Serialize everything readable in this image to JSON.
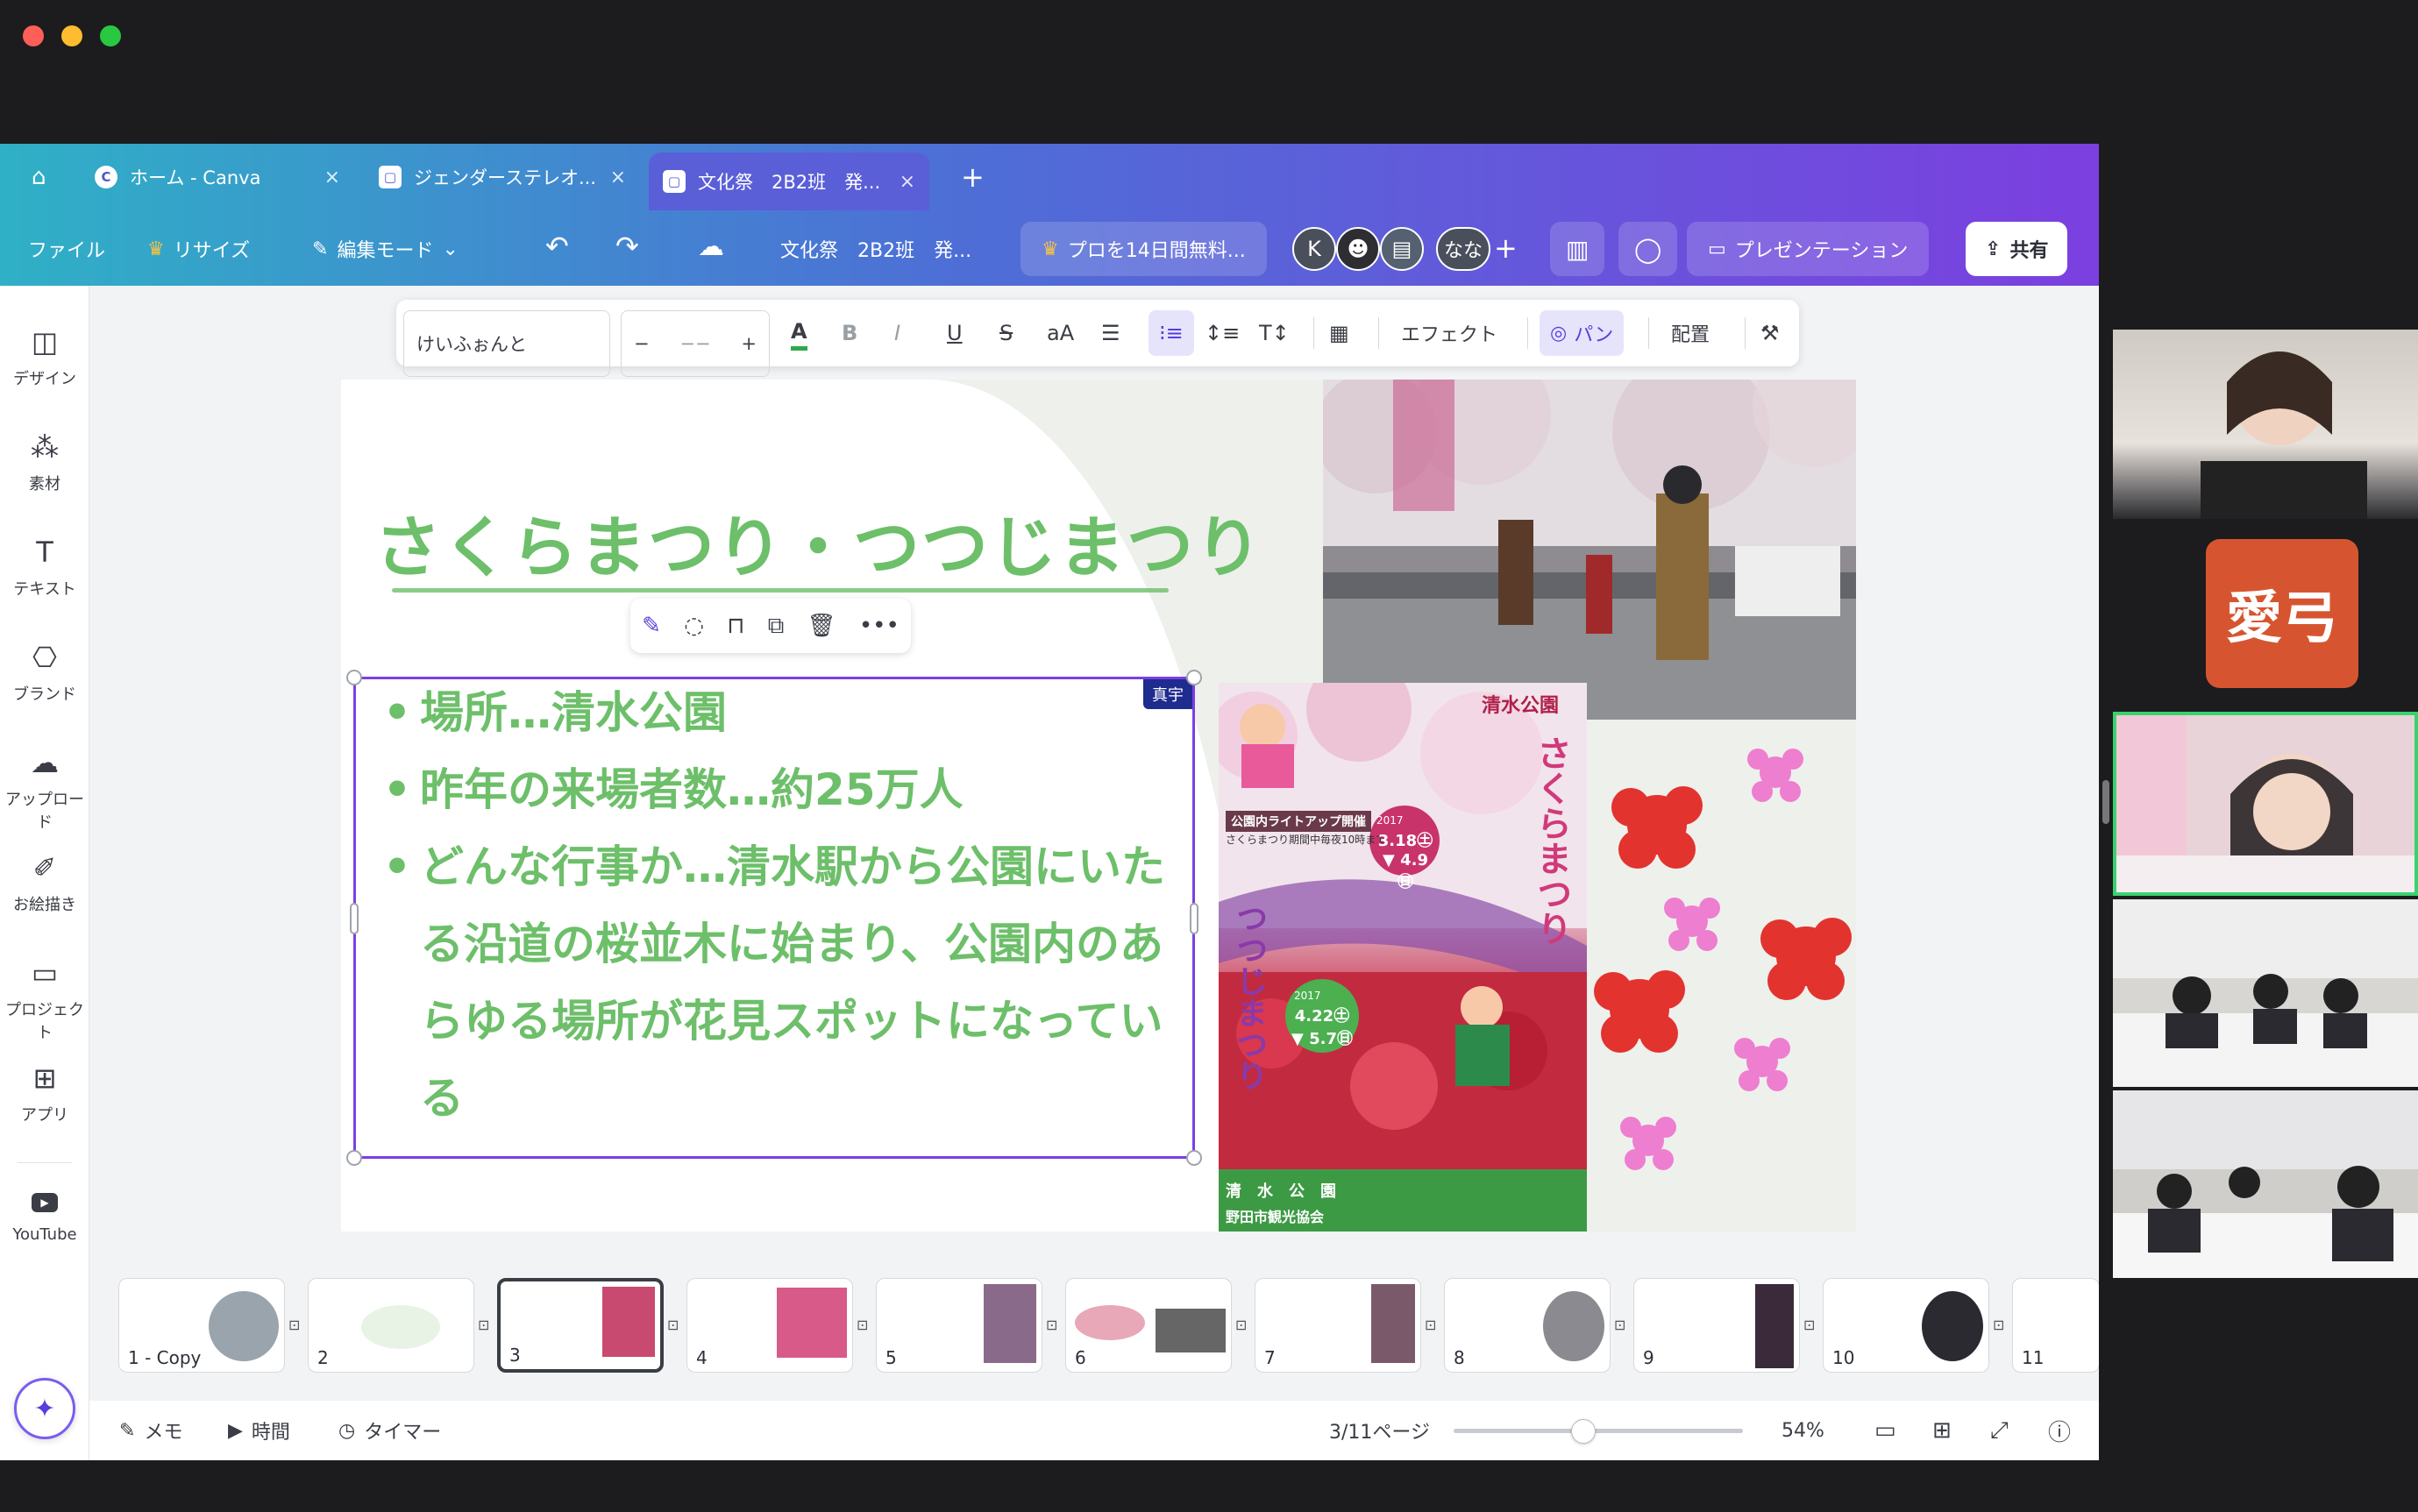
{
  "tabs": [
    {
      "label": "ホーム - Canva"
    },
    {
      "label": "ジェンダーステレオ..."
    },
    {
      "label": "文化祭　2B2班　発..."
    }
  ],
  "menu": {
    "file": "ファイル",
    "resize": "リサイズ",
    "edit_mode": "編集モード",
    "doc_title": "文化祭　2B2班　発...",
    "pro_trial": "プロを14日間無料...",
    "avatar_k": "K",
    "avatar_nana": "なな",
    "present": "プレゼンテーション",
    "share": "共有"
  },
  "sidebar": [
    {
      "label": "デザイン",
      "icon": "design-icon"
    },
    {
      "label": "素材",
      "icon": "elements-icon"
    },
    {
      "label": "テキスト",
      "icon": "text-icon"
    },
    {
      "label": "ブランド",
      "icon": "brand-icon"
    },
    {
      "label": "アップロード",
      "icon": "upload-icon"
    },
    {
      "label": "お絵描き",
      "icon": "draw-icon"
    },
    {
      "label": "プロジェクト",
      "icon": "folder-icon"
    },
    {
      "label": "アプリ",
      "icon": "apps-icon"
    },
    {
      "label": "YouTube",
      "icon": "youtube-icon"
    }
  ],
  "format_toolbar": {
    "font": "けいふぉんと",
    "minus": "−",
    "size": "−−",
    "plus": "+",
    "effects": "エフェクト",
    "pan": "パン",
    "arrange": "配置"
  },
  "slide": {
    "title": "さくらまつり・つつじまつり",
    "editor_badge": "真宇",
    "bullets": [
      "場所…清水公園",
      "昨年の来場者数…約25万人",
      "どんな行事か…清水駅から公園にいたる沿道の桜並木に始まり、公園内のあらゆる場所が花見スポットになっている"
    ],
    "poster": {
      "top_text": "清水公園",
      "sakura": "さくらまつり",
      "tsutsuji": "つつじまつり",
      "lightup_title": "公園内ライトアップ開催",
      "lightup_note": "さくらまつり期間中毎夜10時まで",
      "sakura_dates": "3.18㊏ ▼ 4.9㊐",
      "tsutsuji_dates": "4.22㊏ ▼ 5.7㊐",
      "year1": "2017",
      "year2": "2017",
      "footer1": "清　水　公　園",
      "footer2": "野田市観光協会"
    }
  },
  "thumbnails": [
    {
      "label": "1 - Copy"
    },
    {
      "label": "2"
    },
    {
      "label": "3"
    },
    {
      "label": "4"
    },
    {
      "label": "5"
    },
    {
      "label": "6"
    },
    {
      "label": "7"
    },
    {
      "label": "8"
    },
    {
      "label": "9"
    },
    {
      "label": "10"
    },
    {
      "label": "11"
    }
  ],
  "bottom": {
    "memo": "メモ",
    "time": "時間",
    "timer": "タイマー",
    "page": "3/11ページ",
    "zoom": "54%",
    "zoom_level": 0.54
  },
  "video": {
    "name_tile": "愛弓"
  },
  "colors": {
    "accent_green": "#6dbf6a",
    "selection_purple": "#7b3fe4",
    "gradient_start": "#2fb0c6",
    "gradient_end": "#7c3fe0",
    "name_tile": "#d65530"
  }
}
